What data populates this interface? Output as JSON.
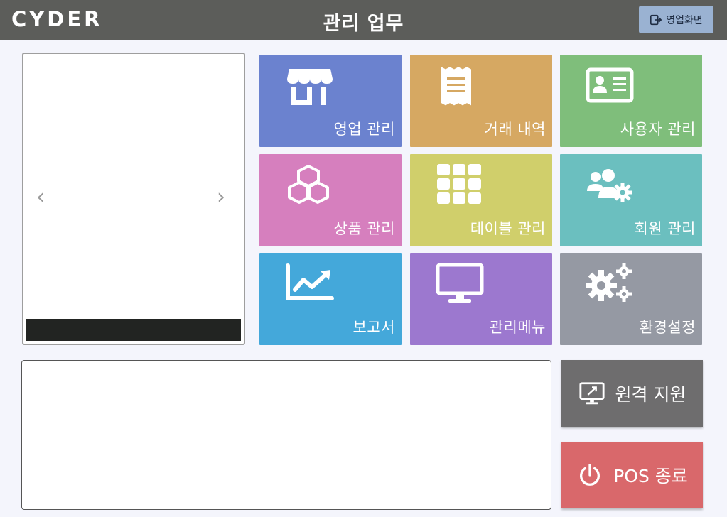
{
  "header": {
    "logo": "CYDER",
    "title": "관리 업무",
    "sales_button_label": "영업화면"
  },
  "slider": {
    "prev_symbol": "‹",
    "next_symbol": "›"
  },
  "tiles": [
    {
      "label": "영업 관리",
      "icon": "store-icon",
      "color": "#6b82cf"
    },
    {
      "label": "거래 내역",
      "icon": "receipt-icon",
      "color": "#d6a862"
    },
    {
      "label": "사용자 관리",
      "icon": "id-card-icon",
      "color": "#7fbe7b"
    },
    {
      "label": "상품 관리",
      "icon": "boxes-icon",
      "color": "#d67fbe"
    },
    {
      "label": "테이블 관리",
      "icon": "grid-icon",
      "color": "#d0cf6b"
    },
    {
      "label": "회원 관리",
      "icon": "users-gear-icon",
      "color": "#6bbfbf"
    },
    {
      "label": "보고서",
      "icon": "chart-line-icon",
      "color": "#44a8da"
    },
    {
      "label": "관리메뉴",
      "icon": "monitor-icon",
      "color": "#9c78cf"
    },
    {
      "label": "환경설정",
      "icon": "gears-icon",
      "color": "#9599a3"
    }
  ],
  "actions": {
    "remote_label": "원격 지원",
    "remote_color": "#6e6d6e",
    "exit_label": "POS 종료",
    "exit_color": "#d9686b"
  }
}
